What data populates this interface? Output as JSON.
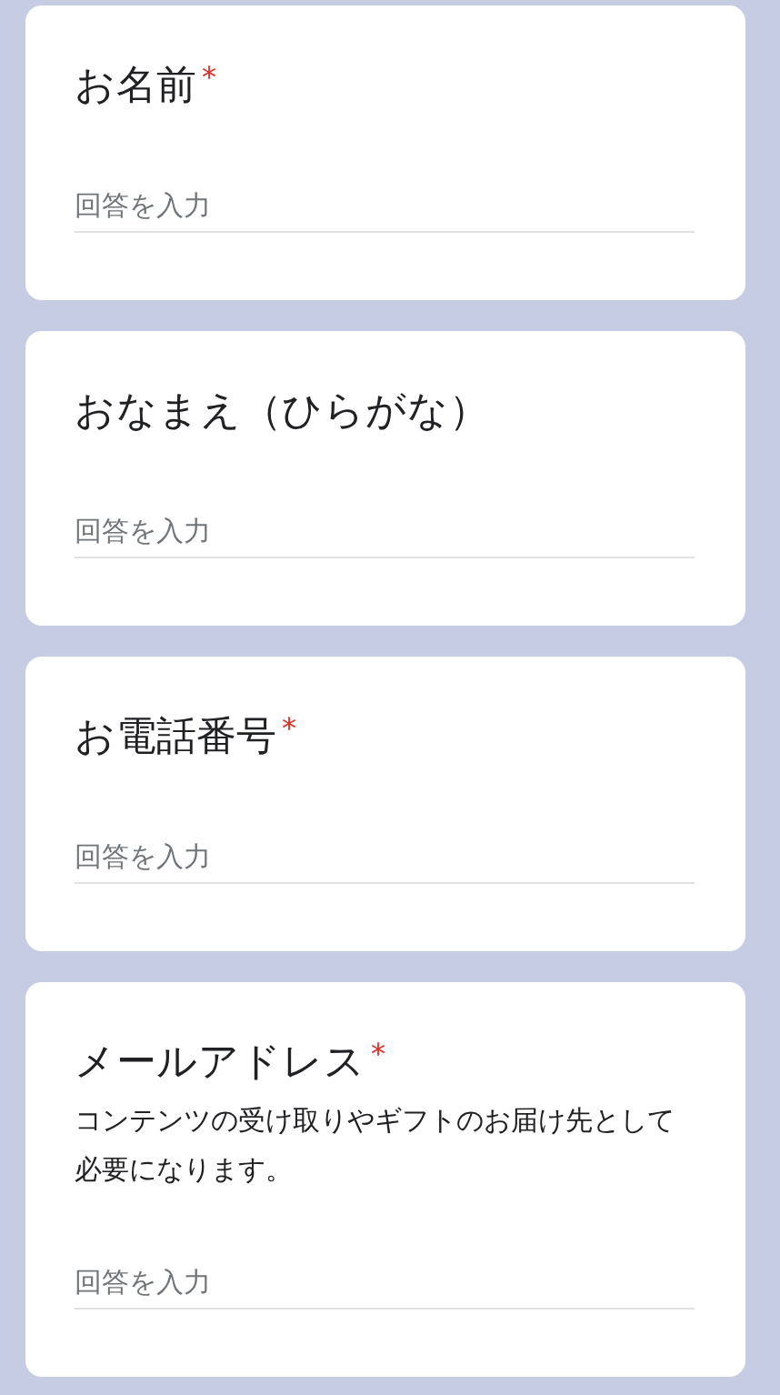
{
  "questions": [
    {
      "title": "お名前",
      "required_mark": "*",
      "placeholder": "回答を入力"
    },
    {
      "title": "おなまえ（ひらがな）",
      "placeholder": "回答を入力"
    },
    {
      "title": "お電話番号",
      "required_mark": "*",
      "placeholder": "回答を入力"
    },
    {
      "title": "メールアドレス",
      "required_mark": "*",
      "description": "コンテンツの受け取りやギフトのお届け先として必要になります。",
      "placeholder": "回答を入力"
    }
  ]
}
